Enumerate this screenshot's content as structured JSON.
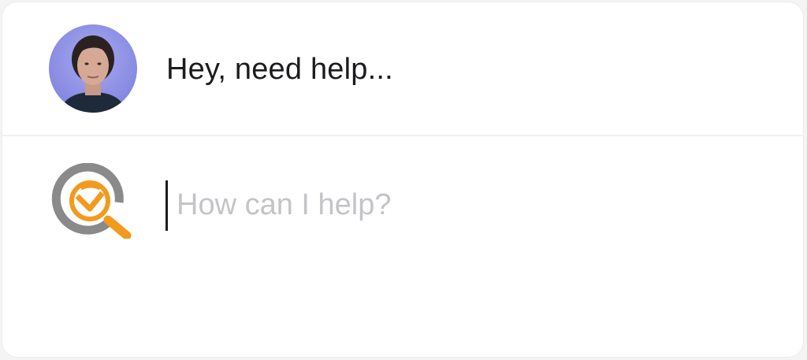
{
  "conversation": {
    "agent_message": "Hey, need help..."
  },
  "composer": {
    "placeholder": "How can I help?",
    "value": ""
  },
  "icons": {
    "agent_avatar": "avatar",
    "brand_logo": "search-logo-icon"
  },
  "colors": {
    "avatar_background": "#8f92e6",
    "logo_ring": "#8a8a8a",
    "logo_accent": "#f39a1e"
  }
}
